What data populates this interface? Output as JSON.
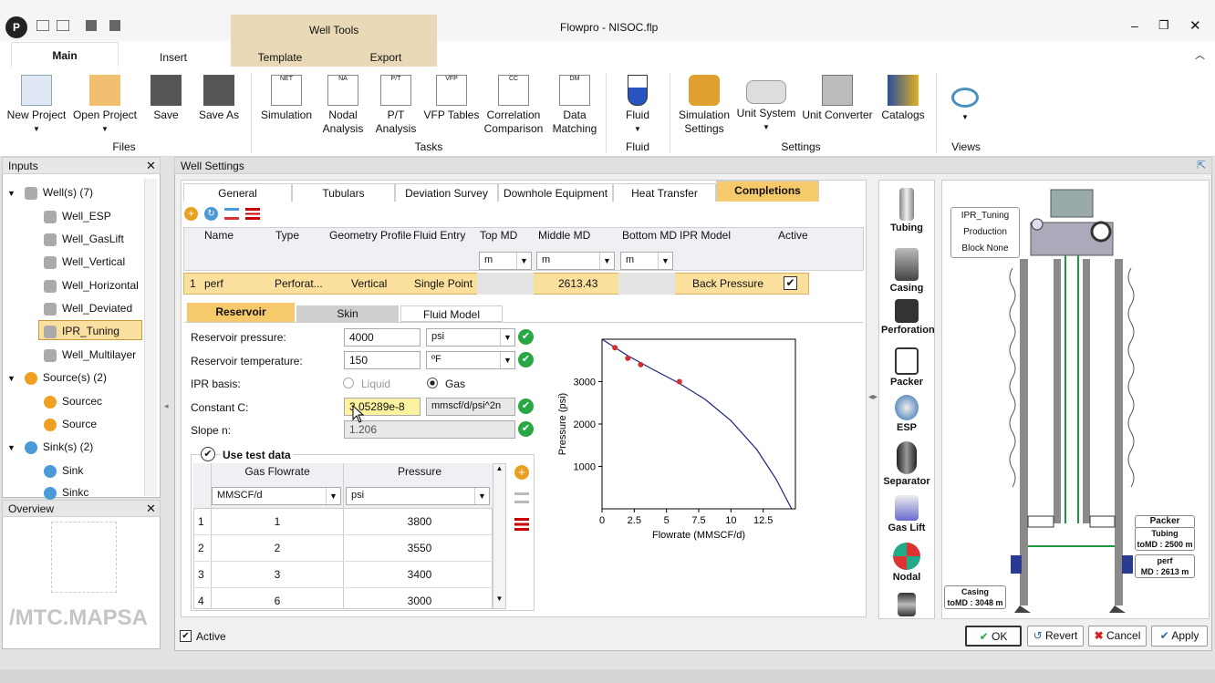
{
  "app": {
    "title": "Flowpro - NISOC.flp",
    "logo": "P",
    "context_tab": "Well Tools"
  },
  "menu": {
    "main": "Main",
    "insert": "Insert",
    "template": "Template",
    "export": "Export"
  },
  "ribbon": {
    "new_project": "New Project",
    "open_project": "Open Project",
    "save": "Save",
    "save_as": "Save As",
    "files": "Files",
    "simulation": "Simulation",
    "nodal": "Nodal",
    "analysis": "Analysis",
    "pt": "P/T",
    "vfp": "VFP Tables",
    "correlation": "Correlation",
    "comparison": "Comparison",
    "data": "Data",
    "matching": "Matching",
    "tasks": "Tasks",
    "fluid": "Fluid",
    "fluid_grp": "Fluid",
    "sim_settings_1": "Simulation",
    "sim_settings_2": "Settings",
    "unit_system": "Unit System",
    "unit_converter": "Unit Converter",
    "catalogs": "Catalogs",
    "settings_grp": "Settings",
    "views": "Views",
    "tags": {
      "net": "NET",
      "na": "NA",
      "pt": "P/T",
      "vfp": "VFP",
      "cc": "CC",
      "dm": "DM"
    }
  },
  "inputs": {
    "title": "Inputs",
    "wells": "Well(s) (7)",
    "items": [
      "Well_ESP",
      "Well_GasLift",
      "Well_Vertical",
      "Well_Horizontal",
      "Well_Deviated",
      "IPR_Tuning",
      "Well_Multilayer"
    ],
    "sources": "Source(s) (2)",
    "source_items": [
      "Sourcec",
      "Source"
    ],
    "sinks": "Sink(s) (2)",
    "sink_items": [
      "Sink",
      "Sinkc"
    ]
  },
  "overview": {
    "title": "Overview"
  },
  "watermark": "/MTC.MAPSA",
  "well_settings": {
    "title": "Well Settings",
    "tabs": [
      "General",
      "Tubulars",
      "Deviation Survey",
      "Downhole Equipment",
      "Heat Transfer",
      "Completions"
    ]
  },
  "grid": {
    "headers": [
      "Name",
      "Type",
      "Geometry Profile",
      "Fluid Entry",
      "Top MD",
      "Middle MD",
      "Bottom MD",
      "IPR Model",
      "Active"
    ],
    "units": [
      "m",
      "m",
      "m"
    ],
    "row": {
      "idx": "1",
      "name": "perf",
      "type": "Perforat...",
      "geometry": "Vertical",
      "fluid_entry": "Single Point",
      "middle_md": "2613.43",
      "ipr": "Back Pressure"
    }
  },
  "subtabs": [
    "Reservoir",
    "Skin",
    "Fluid Model"
  ],
  "reservoir": {
    "pressure_label": "Reservoir pressure:",
    "pressure": "4000",
    "pressure_unit": "psi",
    "temp_label": "Reservoir temperature:",
    "temp": "150",
    "temp_unit": "ºF",
    "ipr_basis_label": "IPR basis:",
    "liquid": "Liquid",
    "gas": "Gas",
    "c_label": "Constant C:",
    "c": "3.05289e-8",
    "c_unit": "mmscf/d/psi^2n",
    "n_label": "Slope n:",
    "n": "1.206",
    "use_test": "Use test data"
  },
  "test_table": {
    "headers": [
      "Gas Flowrate",
      "Pressure"
    ],
    "units": [
      "MMSCF/d",
      "psi"
    ],
    "rows": [
      [
        "1",
        "1",
        "3800"
      ],
      [
        "2",
        "2",
        "3550"
      ],
      [
        "3",
        "3",
        "3400"
      ],
      [
        "4",
        "6",
        "3000"
      ]
    ]
  },
  "chart_data": {
    "type": "line",
    "xlabel": "Flowrate (MMSCF/d)",
    "ylabel": "Pressure (psi)",
    "xlim": [
      0,
      15
    ],
    "ylim": [
      0,
      4000
    ],
    "xticks": [
      "0",
      "2.5",
      "5",
      "7.5",
      "10",
      "12.5"
    ],
    "yticks": [
      "1000",
      "2000",
      "3000"
    ],
    "points": [
      [
        1,
        3800
      ],
      [
        2,
        3550
      ],
      [
        3,
        3400
      ],
      [
        6,
        3000
      ]
    ],
    "curve": [
      [
        0,
        4000
      ],
      [
        2,
        3610
      ],
      [
        4,
        3280
      ],
      [
        6,
        2960
      ],
      [
        8,
        2580
      ],
      [
        10,
        2080
      ],
      [
        12,
        1400
      ],
      [
        13.5,
        700
      ],
      [
        14.7,
        0
      ]
    ]
  },
  "side": {
    "items": [
      "Tubing",
      "Casing",
      "Perforation",
      "Packer",
      "ESP",
      "Separator",
      "Gas Lift",
      "Nodal"
    ]
  },
  "schematic": {
    "info": [
      "IPR_Tuning",
      "Production",
      "Block None"
    ],
    "packer": "Packer",
    "tubing": "Tubing",
    "tubing_md": "toMD : 2500 m",
    "perf": "perf",
    "perf_md": "MD : 2613 m",
    "casing": "Casing",
    "casing_md": "toMD : 3048 m"
  },
  "footer": {
    "active": "Active",
    "ok": "OK",
    "revert": "Revert",
    "cancel": "Cancel",
    "apply": "Apply"
  },
  "colors": {
    "accent": "#f6c96a",
    "ok": "#28a745",
    "cancel": "#d62020"
  }
}
